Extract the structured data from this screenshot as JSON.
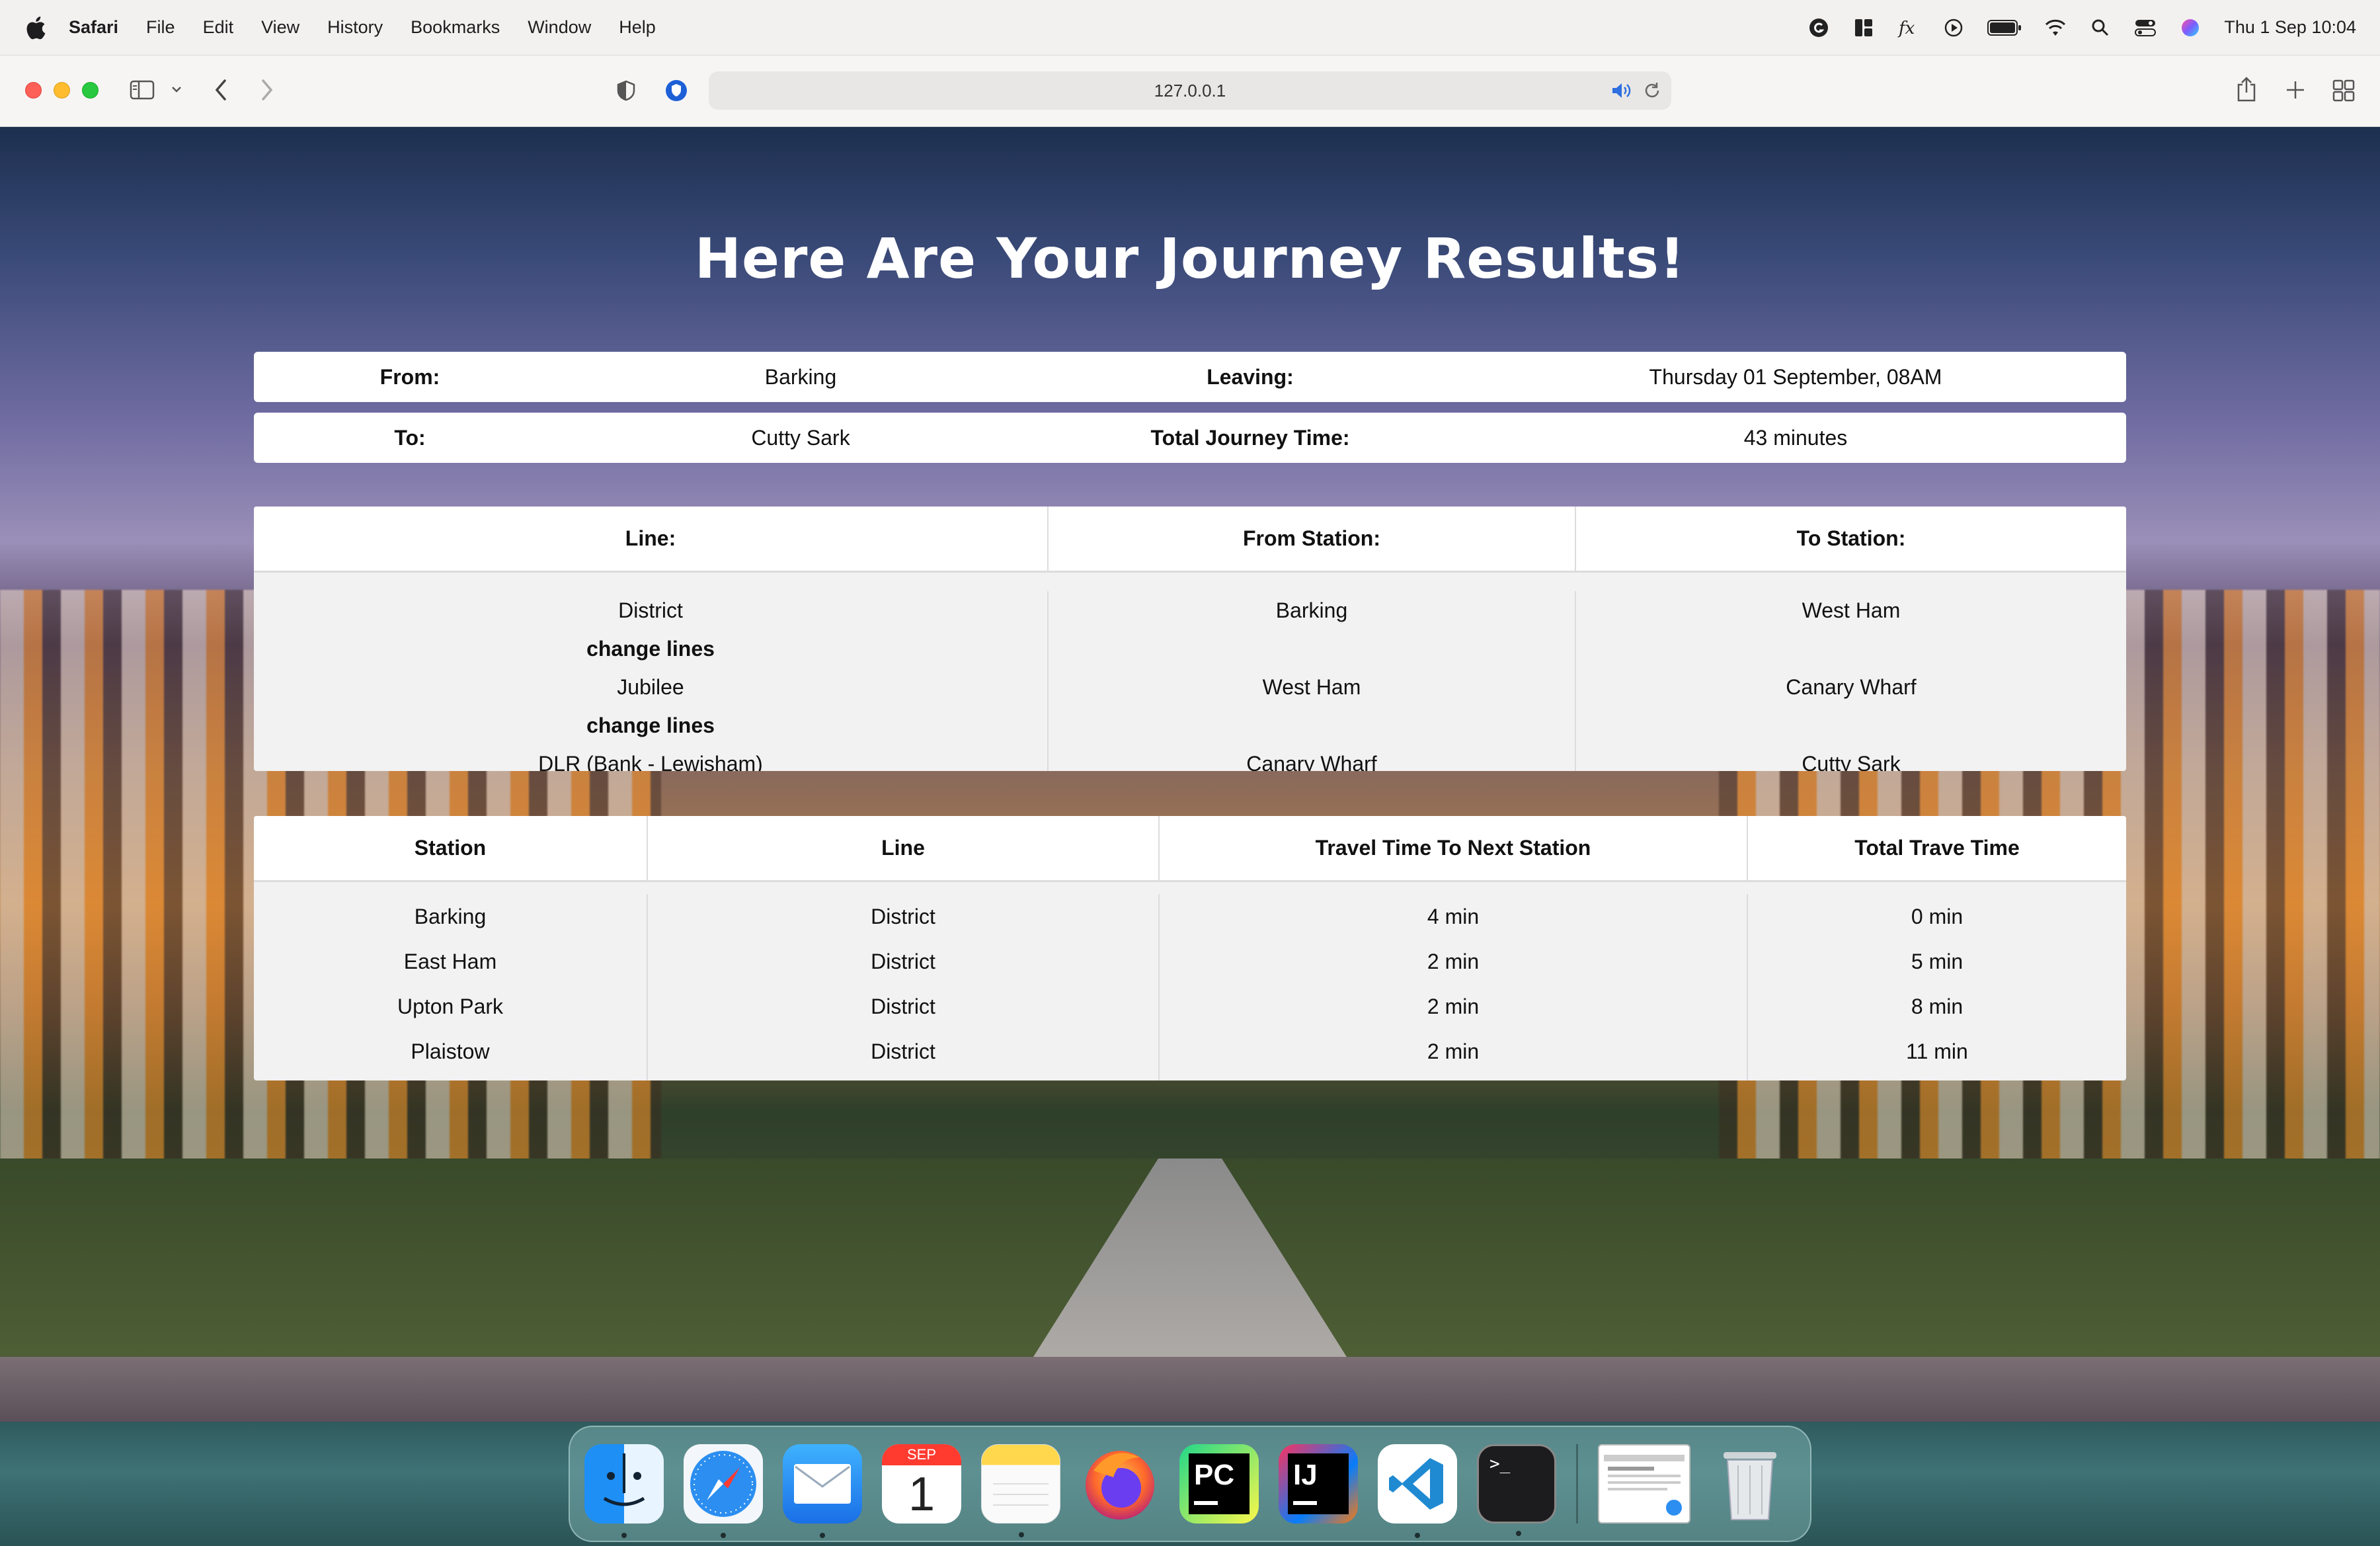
{
  "menubar": {
    "app_name": "Safari",
    "items": [
      "File",
      "Edit",
      "View",
      "History",
      "Bookmarks",
      "Window",
      "Help"
    ],
    "clock": "Thu 1 Sep  10:04"
  },
  "browser": {
    "url": "127.0.0.1"
  },
  "page": {
    "title": "Here Are Your Journey Results!",
    "summary": {
      "from_label": "From:",
      "from_value": "Barking",
      "leaving_label": "Leaving:",
      "leaving_value": "Thursday 01 September, 08AM",
      "to_label": "To:",
      "to_value": "Cutty Sark",
      "total_label": "Total Journey Time:",
      "total_value": "43 minutes"
    },
    "route_table": {
      "headers": [
        "Line:",
        "From Station:",
        "To Station:"
      ],
      "line_col": [
        "District",
        "change lines",
        "Jubilee",
        "change lines",
        "DLR (Bank - Lewisham)"
      ],
      "from_col": [
        "Barking",
        "",
        "West Ham",
        "",
        "Canary Wharf"
      ],
      "to_col": [
        "West Ham",
        "",
        "Canary Wharf",
        "",
        "Cutty Sark"
      ]
    },
    "station_table": {
      "headers": [
        "Station",
        "Line",
        "Travel Time To Next Station",
        "Total Trave Time"
      ],
      "rows": [
        [
          "Barking",
          "District",
          "4 min",
          "0 min"
        ],
        [
          "East Ham",
          "District",
          "2 min",
          "5 min"
        ],
        [
          "Upton Park",
          "District",
          "2 min",
          "8 min"
        ],
        [
          "Plaistow",
          "District",
          "2 min",
          "11 min"
        ]
      ]
    }
  },
  "dock": {
    "calendar_month": "SEP",
    "calendar_day": "1",
    "pycharm_label": "PC",
    "intellij_label": "IJ",
    "terminal_prompt": ">_"
  }
}
